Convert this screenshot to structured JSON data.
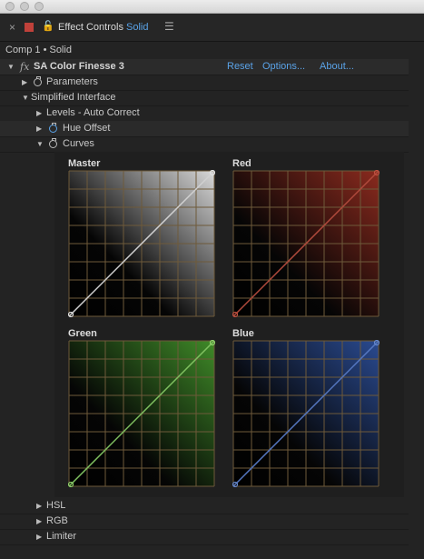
{
  "tab": {
    "title": "Effect Controls",
    "layer": "Solid"
  },
  "breadcrumb": "Comp 1 • Solid",
  "effect": {
    "name": "SA Color Finesse 3",
    "reset": "Reset",
    "options": "Options...",
    "about": "About..."
  },
  "tree": {
    "parameters": "Parameters",
    "simplified": "Simplified Interface",
    "levels": "Levels - Auto Correct",
    "hue_offset": "Hue Offset",
    "curves": "Curves",
    "hsl": "HSL",
    "rgb": "RGB",
    "limiter": "Limiter"
  },
  "curves": [
    {
      "label": "Master",
      "line_color": "#d0d0d0",
      "point_color": "#e0e0e0",
      "tint": "#d8d8d8"
    },
    {
      "label": "Red",
      "line_color": "#b04a3c",
      "point_color": "#c05040",
      "tint": "#8a2a1e"
    },
    {
      "label": "Green",
      "line_color": "#7fc060",
      "point_color": "#8ed06a",
      "tint": "#3f8a28"
    },
    {
      "label": "Blue",
      "line_color": "#5577c0",
      "point_color": "#6688cc",
      "tint": "#2a4a90"
    }
  ],
  "colors": {
    "grid": "#6e5a3a",
    "accent": "#5aa3e8"
  }
}
